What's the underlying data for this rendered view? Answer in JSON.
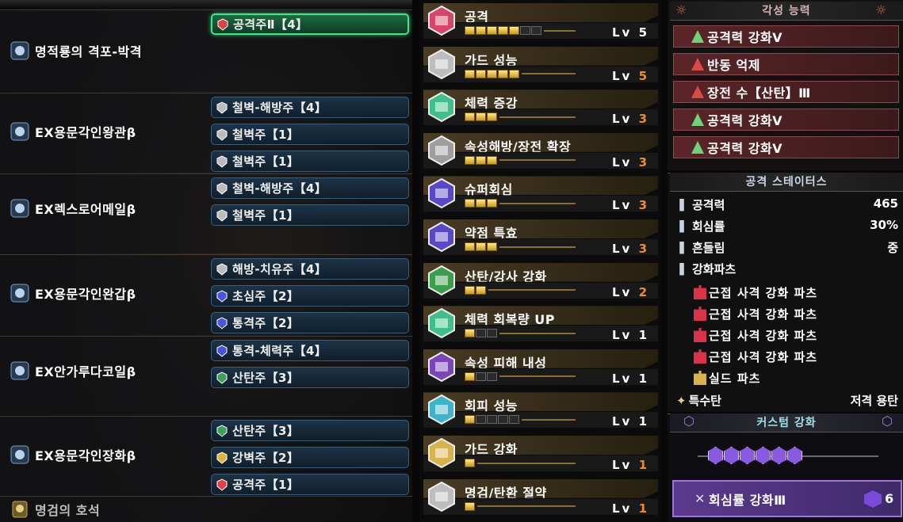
{
  "equipment": [
    {
      "name": "명적룡의 격포-박격",
      "icon": "weapon-icon",
      "slots": [
        {
          "label": "공격주Ⅱ【4】",
          "jewel": "red",
          "selected": true
        }
      ]
    },
    {
      "name": "EX용문각인왕관β",
      "icon": "helm-icon",
      "slots": [
        {
          "label": "철벽-해방주【4】",
          "jewel": "grey"
        },
        {
          "label": "철벽주【1】",
          "jewel": "grey"
        },
        {
          "label": "철벽주【1】",
          "jewel": "grey"
        }
      ]
    },
    {
      "name": "EX렉스로어메일β",
      "icon": "chest-icon",
      "slots": [
        {
          "label": "철벽-해방주【4】",
          "jewel": "grey"
        },
        {
          "label": "철벽주【1】",
          "jewel": "grey"
        }
      ]
    },
    {
      "name": "EX용문각인완갑β",
      "icon": "arm-icon",
      "slots": [
        {
          "label": "해방-치유주【4】",
          "jewel": "grey"
        },
        {
          "label": "초심주【2】",
          "jewel": "blue"
        },
        {
          "label": "통격주【2】",
          "jewel": "blue"
        }
      ]
    },
    {
      "name": "EX안가루다코일β",
      "icon": "waist-icon",
      "slots": [
        {
          "label": "통격-체력주【4】",
          "jewel": "blue"
        },
        {
          "label": "산탄주【3】",
          "jewel": "green"
        }
      ]
    },
    {
      "name": "EX용문각인장화β",
      "icon": "leg-icon",
      "slots": [
        {
          "label": "산탄주【3】",
          "jewel": "green"
        },
        {
          "label": "강벽주【2】",
          "jewel": "yellow"
        },
        {
          "label": "공격주【1】",
          "jewel": "red"
        }
      ]
    }
  ],
  "charm": {
    "name": "명검의 호석",
    "icon": "charm-icon"
  },
  "skills": [
    {
      "name": "공격",
      "color": "#d8456a",
      "pips": 5,
      "max": 7,
      "lv_label": "Lv",
      "lv": "5",
      "lv_color": "#ffffff"
    },
    {
      "name": "가드 성능",
      "color": "#bdbdbd",
      "pips": 5,
      "max": 5,
      "lv_label": "Lv",
      "lv": "5",
      "lv_color": "#f08c2a"
    },
    {
      "name": "체력 증강",
      "color": "#3fbf8a",
      "pips": 3,
      "max": 3,
      "lv_label": "Lv",
      "lv": "3",
      "lv_color": "#f08c2a"
    },
    {
      "name": "속성해방/장전 확장",
      "color": "#9e9e9e",
      "pips": 3,
      "max": 3,
      "lv_label": "Lv",
      "lv": "3",
      "lv_color": "#f08c2a"
    },
    {
      "name": "슈퍼회심",
      "color": "#5a48c8",
      "pips": 3,
      "max": 3,
      "lv_label": "Lv",
      "lv": "3",
      "lv_color": "#f08c2a"
    },
    {
      "name": "약점 특효",
      "color": "#5a48c8",
      "pips": 3,
      "max": 3,
      "lv_label": "Lv",
      "lv": "3",
      "lv_color": "#f08c2a"
    },
    {
      "name": "산탄/강사 강화",
      "color": "#3a9e4a",
      "pips": 2,
      "max": 2,
      "lv_label": "Lv",
      "lv": "2",
      "lv_color": "#f08c2a"
    },
    {
      "name": "체력 회복량 UP",
      "color": "#3fbf8a",
      "pips": 1,
      "max": 3,
      "lv_label": "Lv",
      "lv": "1",
      "lv_color": "#ffffff"
    },
    {
      "name": "속성 피해 내성",
      "color": "#7a45b8",
      "pips": 1,
      "max": 3,
      "lv_label": "Lv",
      "lv": "1",
      "lv_color": "#ffffff"
    },
    {
      "name": "회피 성능",
      "color": "#3fb3c8",
      "pips": 1,
      "max": 5,
      "lv_label": "Lv",
      "lv": "1",
      "lv_color": "#ffffff"
    },
    {
      "name": "가드 강화",
      "color": "#d8b24a",
      "pips": 1,
      "max": 1,
      "lv_label": "Lv",
      "lv": "1",
      "lv_color": "#f08c2a"
    },
    {
      "name": "명검/탄환 절약",
      "color": "#bdbdbd",
      "pips": 1,
      "max": 1,
      "lv_label": "Lv",
      "lv": "1",
      "lv_color": "#f08c2a"
    }
  ],
  "awakening": {
    "title": "각성 능력",
    "items": [
      {
        "label": "공격력 강화Ⅴ",
        "icon": "attack-up-icon"
      },
      {
        "label": "반동 억제",
        "icon": "recoil-icon"
      },
      {
        "label": "장전 수【산탄】Ⅲ",
        "icon": "capacity-icon"
      },
      {
        "label": "공격력 강화Ⅴ",
        "icon": "attack-up-icon"
      },
      {
        "label": "공격력 강화Ⅴ",
        "icon": "attack-up-icon"
      }
    ]
  },
  "status": {
    "title": "공격 스테이터스",
    "rows": [
      {
        "label": "공격력",
        "value": "465",
        "icon": "attack-icon"
      },
      {
        "label": "회심률",
        "value": "30%",
        "icon": "affinity-icon"
      },
      {
        "label": "흔들림",
        "value": "중",
        "icon": "deviation-icon"
      },
      {
        "label": "강화파츠",
        "value": "",
        "icon": "mod-icon"
      }
    ],
    "parts": [
      {
        "label": "근접 사격 강화 파츠",
        "color": "#d8334a"
      },
      {
        "label": "근접 사격 강화 파츠",
        "color": "#d8334a"
      },
      {
        "label": "근접 사격 강화 파츠",
        "color": "#d8334a"
      },
      {
        "label": "근접 사격 강화 파츠",
        "color": "#d8334a"
      },
      {
        "label": "실드 파츠",
        "color": "#d8b24a"
      }
    ],
    "special": {
      "label": "특수탄",
      "value": "저격 용탄",
      "icon": "special-ammo-icon"
    }
  },
  "custom": {
    "title": "커스텀 강화",
    "slots_filled": 6,
    "item_label": "회심률 강화Ⅲ",
    "item_icon": "affinity-icon",
    "count": "6"
  },
  "colors": {
    "jewel_red": "#e0404a",
    "jewel_grey": "#bcbcbc",
    "jewel_blue": "#4a54d8",
    "jewel_green": "#3fa05a",
    "jewel_yellow": "#e0b43a",
    "lv_max": "#f08c2a"
  }
}
